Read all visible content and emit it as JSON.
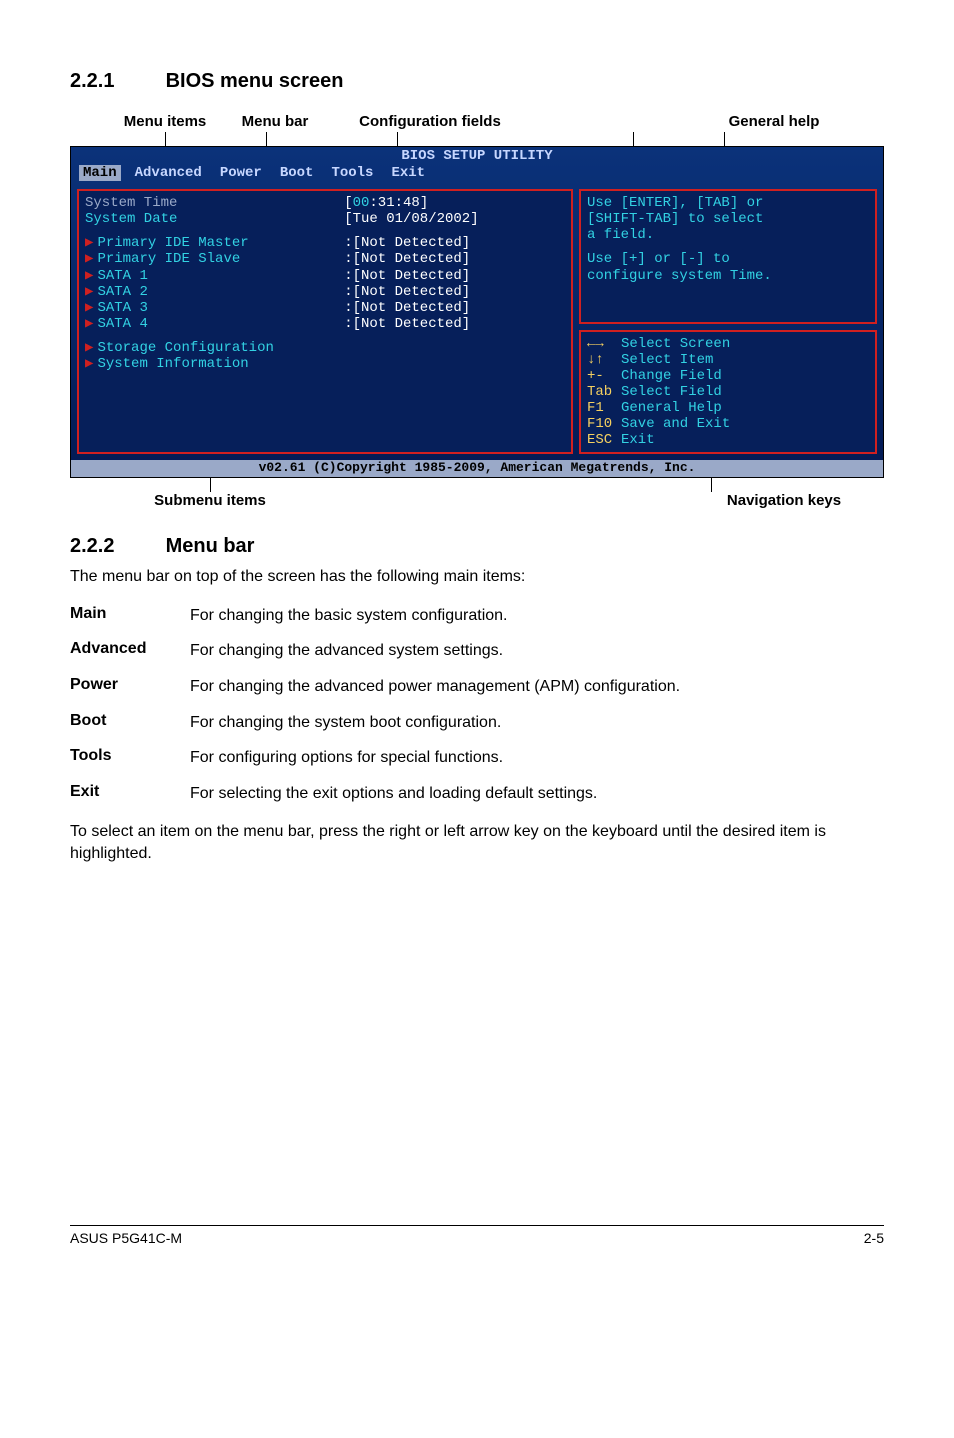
{
  "headings": {
    "h221_num": "2.2.1",
    "h221_title": "BIOS menu screen",
    "h222_num": "2.2.2",
    "h222_title": "Menu bar"
  },
  "annotations": {
    "menu_items": "Menu items",
    "menu_bar": "Menu bar",
    "config_fields": "Configuration fields",
    "general_help": "General help",
    "submenu_items": "Submenu items",
    "nav_keys": "Navigation keys"
  },
  "bios": {
    "title": "BIOS SETUP UTILITY",
    "tabs": [
      "Main",
      "Advanced",
      "Power",
      "Boot",
      "Tools",
      "Exit"
    ],
    "left": {
      "system_time_label": "System Time",
      "system_time_value_hh": "00",
      "system_time_value_rest": ":31:48",
      "system_date_label": "System Date",
      "system_date_value": "[Tue 01/08/2002]",
      "rows": [
        {
          "label": "Primary IDE Master",
          "value": ":[Not Detected]"
        },
        {
          "label": "Primary IDE Slave",
          "value": ":[Not Detected]"
        },
        {
          "label": "SATA 1",
          "value": ":[Not Detected]"
        },
        {
          "label": "SATA 2",
          "value": ":[Not Detected]"
        },
        {
          "label": "SATA 3",
          "value": ":[Not Detected]"
        },
        {
          "label": "SATA 4",
          "value": ":[Not Detected]"
        }
      ],
      "storage_config": "Storage Configuration",
      "system_info": "System Information"
    },
    "help_top": {
      "line1": "Use [ENTER], [TAB] or",
      "line2": "[SHIFT-TAB] to select",
      "line3": "a field.",
      "line4": "Use [+] or [-] to",
      "line5": "configure system Time."
    },
    "help_bottom": [
      {
        "key": "←→",
        "txt": "Select Screen"
      },
      {
        "key": "↓↑",
        "txt": "Select Item"
      },
      {
        "key": "+-",
        "txt": "Change Field"
      },
      {
        "key": "Tab",
        "txt": "Select Field"
      },
      {
        "key": "F1",
        "txt": "General Help"
      },
      {
        "key": "F10",
        "txt": "Save and Exit"
      },
      {
        "key": "ESC",
        "txt": "Exit"
      }
    ],
    "footer": "v02.61 (C)Copyright 1985-2009, American Megatrends, Inc."
  },
  "menu_bar_section": {
    "intro": "The menu bar on top of the screen has the following main items:",
    "rows": [
      {
        "term": "Main",
        "desc": "For changing the basic system configuration."
      },
      {
        "term": "Advanced",
        "desc": "For changing the advanced system settings."
      },
      {
        "term": "Power",
        "desc": "For changing the advanced power management (APM) configuration."
      },
      {
        "term": "Boot",
        "desc": "For changing the system boot configuration."
      },
      {
        "term": "Tools",
        "desc": "For configuring options for special functions."
      },
      {
        "term": "Exit",
        "desc": "For selecting the exit options and loading default settings."
      }
    ],
    "outro": "To select an item on the menu bar, press the right or left arrow key on the keyboard until the desired item is highlighted."
  },
  "footer": {
    "left": "ASUS P5G41C-M",
    "right": "2-5"
  }
}
